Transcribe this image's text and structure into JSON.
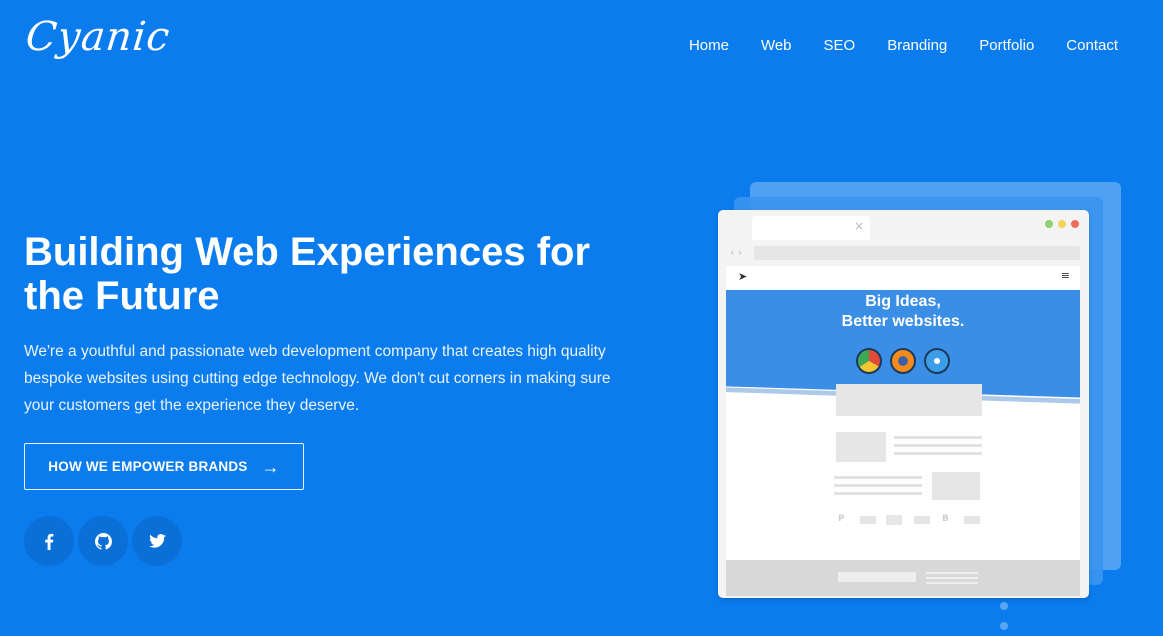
{
  "logo": {
    "text": "Cyanic"
  },
  "nav": {
    "items": [
      "Home",
      "Web",
      "SEO",
      "Branding",
      "Portfolio",
      "Contact"
    ]
  },
  "hero": {
    "title": "Building Web Experiences for the Future",
    "description": "We're a youthful and passionate web development company that creates high quality bespoke websites using cutting edge technology. We don't cut corners in making sure your customers get the experience they deserve.",
    "cta_label": "HOW WE EMPOWER BRANDS"
  },
  "social": {
    "icons": [
      "facebook-icon",
      "github-icon",
      "twitter-icon"
    ]
  },
  "illustration": {
    "banner_line1": "Big Ideas,",
    "banner_line2": "Better websites.",
    "payment_glyph": "B"
  },
  "colors": {
    "background": "#0a7cee",
    "social_circle": "#0a6fd6",
    "banner": "#3b8ee6"
  }
}
